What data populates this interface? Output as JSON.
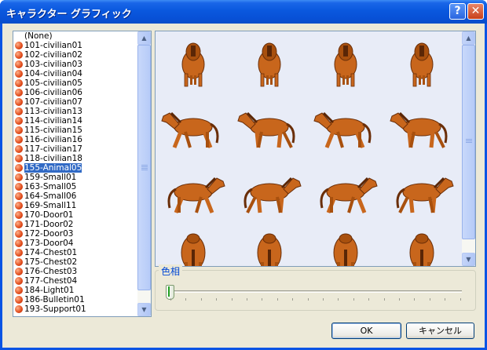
{
  "window": {
    "title": "キャラクター グラフィック",
    "help_glyph": "?",
    "close_glyph": "✕"
  },
  "list": {
    "selected_index": 16,
    "items": [
      {
        "label": "(None)",
        "icon": false
      },
      {
        "label": "101-civilian01",
        "icon": true
      },
      {
        "label": "102-civilian02",
        "icon": true
      },
      {
        "label": "103-civilian03",
        "icon": true
      },
      {
        "label": "104-civilian04",
        "icon": true
      },
      {
        "label": "105-civilian05",
        "icon": true
      },
      {
        "label": "106-civilian06",
        "icon": true
      },
      {
        "label": "107-civilian07",
        "icon": true
      },
      {
        "label": "113-civilian13",
        "icon": true
      },
      {
        "label": "114-civilian14",
        "icon": true
      },
      {
        "label": "115-civilian15",
        "icon": true
      },
      {
        "label": "116-civilian16",
        "icon": true
      },
      {
        "label": "117-civilian17",
        "icon": true
      },
      {
        "label": "118-civilian18",
        "icon": true
      },
      {
        "label": "155-Animal05",
        "icon": true
      },
      {
        "label": "159-Small01",
        "icon": true
      },
      {
        "label": "163-Small05",
        "icon": true
      },
      {
        "label": "164-Small06",
        "icon": true
      },
      {
        "label": "169-Small11",
        "icon": true
      },
      {
        "label": "170-Door01",
        "icon": true
      },
      {
        "label": "171-Door02",
        "icon": true
      },
      {
        "label": "172-Door03",
        "icon": true
      },
      {
        "label": "173-Door04",
        "icon": true
      },
      {
        "label": "174-Chest01",
        "icon": true
      },
      {
        "label": "175-Chest02",
        "icon": true
      },
      {
        "label": "176-Chest03",
        "icon": true
      },
      {
        "label": "177-Chest04",
        "icon": true
      },
      {
        "label": "184-Light01",
        "icon": true
      },
      {
        "label": "186-Bulletin01",
        "icon": true
      },
      {
        "label": "193-Support01",
        "icon": true
      }
    ]
  },
  "icons": {
    "item_icon": "graphic-file-icon",
    "scroll_up": "chevron-up-icon",
    "scroll_down": "chevron-down-icon"
  },
  "preview": {
    "rows": [
      "down",
      "left",
      "right",
      "up"
    ],
    "frames_per_row": 4,
    "horse_color": "#c8661c"
  },
  "hue": {
    "label": "色相",
    "value": 0
  },
  "buttons": {
    "ok": "OK",
    "cancel": "キャンセル"
  },
  "colors": {
    "title_bar": "#0a58de",
    "selection": "#316ac5",
    "dialog_bg": "#ece9d8"
  }
}
